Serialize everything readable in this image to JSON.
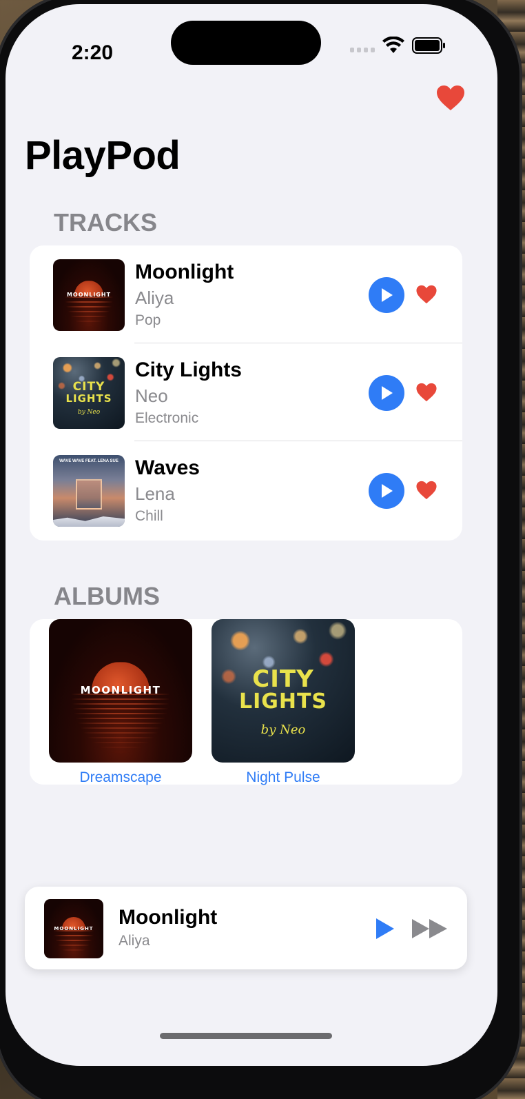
{
  "status_bar": {
    "time": "2:20"
  },
  "app": {
    "title": "PlayPod"
  },
  "colors": {
    "accent": "#2f7cf6",
    "favorite": "#e8483a",
    "background": "#f2f2f7",
    "secondary_text": "#8a8a8e"
  },
  "sections": {
    "tracks": "TRACKS",
    "albums": "ALBUMS"
  },
  "tracks": [
    {
      "title": "Moonlight",
      "artist": "Aliya",
      "genre": "Pop",
      "artwork": "moonlight-cover",
      "artwork_text": "MOONLIGHT"
    },
    {
      "title": "City Lights",
      "artist": "Neo",
      "genre": "Electronic",
      "artwork": "city-lights-cover",
      "artwork_text_1": "CITY",
      "artwork_text_2": "LIGHTS",
      "artwork_signature": "by Neo"
    },
    {
      "title": "Waves",
      "artist": "Lena",
      "genre": "Chill",
      "artwork": "waves-cover",
      "artwork_text": "WAVE WAVE FEAT. LENA SUE"
    }
  ],
  "albums": [
    {
      "name": "Dreamscape",
      "artwork": "moonlight-cover",
      "artwork_text": "MOONLIGHT"
    },
    {
      "name": "Night Pulse",
      "artwork": "city-lights-cover",
      "artwork_text_1": "CITY",
      "artwork_text_2": "LIGHTS",
      "artwork_signature": "by Neo"
    }
  ],
  "now_playing": {
    "title": "Moonlight",
    "artist": "Aliya",
    "artwork": "moonlight-cover",
    "artwork_text": "MOONLIGHT"
  },
  "icons": {
    "favorites": "heart-icon",
    "play": "play-icon",
    "fast_forward": "fast-forward-icon",
    "wifi": "wifi-icon",
    "battery": "battery-icon",
    "signal": "cellular-signal-icon"
  }
}
